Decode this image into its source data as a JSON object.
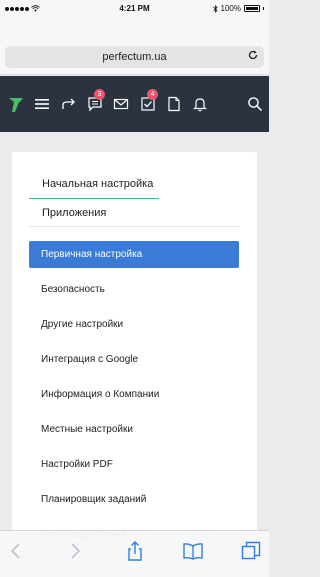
{
  "status_bar": {
    "time": "4:21 PM",
    "battery": "100%"
  },
  "browser": {
    "url": "perfectum.ua"
  },
  "header": {
    "icons": [
      "logo-icon",
      "menu-icon",
      "share-arrow-icon",
      "messages-icon",
      "mail-icon",
      "tasks-icon",
      "document-icon",
      "bell-icon",
      "search-icon"
    ],
    "messages_badge": "3",
    "tasks_badge": "4",
    "accent": "#2b3240"
  },
  "tabs": [
    {
      "label": "Начальная настройка",
      "active": true
    },
    {
      "label": "Приложения",
      "active": false
    }
  ],
  "menu": [
    {
      "label": "Первичная настройка",
      "active": true
    },
    {
      "label": "Безопасность",
      "active": false
    },
    {
      "label": "Другие настройки",
      "active": false
    },
    {
      "label": "Интеграция с Google",
      "active": false
    },
    {
      "label": "Информация о Компании",
      "active": false
    },
    {
      "label": "Местные настройки",
      "active": false
    },
    {
      "label": "Настройки PDF",
      "active": false
    },
    {
      "label": "Планировщик заданий",
      "active": false
    },
    {
      "label": "Пуш-уведомления",
      "active": false
    }
  ],
  "colors": {
    "active_menu": "#3a7bd5",
    "active_tab_underline": "#4cbb6c",
    "badge": "#e9566c",
    "logo": "#4cbb6c"
  },
  "toolbar": {
    "icons": [
      "back-icon",
      "forward-icon",
      "share-icon",
      "bookmarks-icon",
      "tabs-icon"
    ]
  }
}
